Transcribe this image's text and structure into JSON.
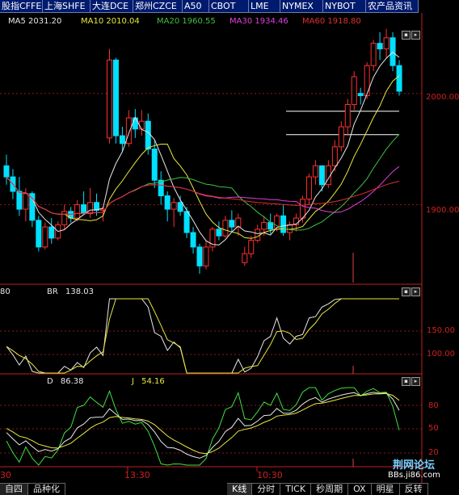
{
  "exchange_tabs": [
    "股指CFFEX",
    "上海SHFE",
    "大连DCE",
    "郑州CZCE",
    "A50",
    "CBOT",
    "LME",
    "NYMEX",
    "NYBOT",
    "农产品资讯"
  ],
  "ma_legend": [
    {
      "label": "MA5 2031.20",
      "color": "#e8e8e8"
    },
    {
      "label": "MA10 2010.04",
      "color": "#e8e840"
    },
    {
      "label": "MA20 1960.55",
      "color": "#40c040"
    },
    {
      "label": "MA30 1934.46",
      "color": "#e040e0"
    },
    {
      "label": "MA60  1918.80",
      "color": "#e03030"
    }
  ],
  "price_axis": [
    "2000.00",
    "1900.00"
  ],
  "br_panel": {
    "left": "80",
    "name": "BR",
    "value": "138.03",
    "axis": [
      "150.00",
      "100.00"
    ]
  },
  "kdj_panel": {
    "d_label": "D",
    "d_value": "86.38",
    "j_label": "J",
    "j_value": "54.16",
    "axis": [
      "80",
      "50",
      "20"
    ]
  },
  "time_axis": [
    "13:30",
    "10:30"
  ],
  "left_time_fragment": "30",
  "bottom_tabs": [
    "自四",
    "品种化",
    "K线",
    "分时",
    "TICK",
    "秒周期",
    "OX",
    "明星",
    "反转"
  ],
  "watermark": {
    "main": "荆网论坛",
    "sub": "BBs.ji86.com"
  },
  "chart_data": {
    "type": "candlestick",
    "price_range": [
      1830,
      2060
    ],
    "candles_ohlc": [
      [
        1935,
        1945,
        1918,
        1925
      ],
      [
        1925,
        1932,
        1905,
        1912
      ],
      [
        1912,
        1925,
        1890,
        1896
      ],
      [
        1896,
        1915,
        1885,
        1910
      ],
      [
        1910,
        1912,
        1880,
        1886
      ],
      [
        1886,
        1890,
        1858,
        1862
      ],
      [
        1862,
        1884,
        1860,
        1880
      ],
      [
        1880,
        1888,
        1865,
        1870
      ],
      [
        1870,
        1885,
        1868,
        1882
      ],
      [
        1882,
        1900,
        1878,
        1894
      ],
      [
        1894,
        1898,
        1884,
        1888
      ],
      [
        1888,
        1904,
        1885,
        1900
      ],
      [
        1900,
        1912,
        1895,
        1892
      ],
      [
        1892,
        1915,
        1888,
        1902
      ],
      [
        1902,
        1910,
        1890,
        1895
      ],
      [
        1895,
        1898,
        1885,
        1896
      ],
      [
        1960,
        2040,
        1955,
        2030
      ],
      [
        2030,
        2032,
        1955,
        1962
      ],
      [
        1962,
        1970,
        1948,
        1955
      ],
      [
        1955,
        1985,
        1952,
        1978
      ],
      [
        1978,
        1986,
        1960,
        1968
      ],
      [
        1968,
        1985,
        1962,
        1975
      ],
      [
        1975,
        1982,
        1945,
        1950
      ],
      [
        1950,
        1958,
        1915,
        1922
      ],
      [
        1922,
        1930,
        1900,
        1908
      ],
      [
        1908,
        1912,
        1885,
        1896
      ],
      [
        1896,
        1906,
        1880,
        1902
      ],
      [
        1902,
        1908,
        1890,
        1894
      ],
      [
        1894,
        1898,
        1870,
        1875
      ],
      [
        1875,
        1880,
        1856,
        1862
      ],
      [
        1862,
        1865,
        1838,
        1845
      ],
      [
        1845,
        1868,
        1842,
        1862
      ],
      [
        1862,
        1880,
        1858,
        1878
      ],
      [
        1878,
        1885,
        1868,
        1872
      ],
      [
        1872,
        1890,
        1870,
        1886
      ],
      [
        1886,
        1895,
        1876,
        1880
      ],
      [
        1880,
        1892,
        1872,
        1888
      ],
      [
        1848,
        1862,
        1845,
        1856
      ],
      [
        1856,
        1872,
        1852,
        1868
      ],
      [
        1868,
        1882,
        1866,
        1878
      ],
      [
        1878,
        1890,
        1872,
        1884
      ],
      [
        1884,
        1892,
        1874,
        1878
      ],
      [
        1878,
        1892,
        1876,
        1890
      ],
      [
        1890,
        1900,
        1872,
        1875
      ],
      [
        1875,
        1885,
        1868,
        1882
      ],
      [
        1882,
        1892,
        1876,
        1888
      ],
      [
        1888,
        1908,
        1884,
        1905
      ],
      [
        1905,
        1928,
        1900,
        1925
      ],
      [
        1925,
        1940,
        1918,
        1935
      ],
      [
        1935,
        1935,
        1912,
        1918
      ],
      [
        1918,
        1940,
        1915,
        1935
      ],
      [
        1935,
        1958,
        1930,
        1952
      ],
      [
        1952,
        1975,
        1948,
        1970
      ],
      [
        1970,
        1995,
        1962,
        1990
      ],
      [
        1990,
        2020,
        1985,
        2015
      ],
      [
        2000,
        2005,
        1990,
        1998
      ],
      [
        1998,
        2028,
        1995,
        2025
      ],
      [
        2025,
        2048,
        2020,
        2045
      ],
      [
        2045,
        2055,
        2030,
        2040
      ],
      [
        2040,
        2058,
        2032,
        2050
      ],
      [
        2050,
        2055,
        2020,
        2025
      ],
      [
        2025,
        2030,
        1998,
        2002
      ]
    ],
    "ma_series_names": [
      "MA5",
      "MA10",
      "MA20",
      "MA30",
      "MA60"
    ],
    "horizontal_lines": [
      1984,
      1963
    ],
    "br_range": [
      60,
      200
    ],
    "kdj_range": [
      0,
      100
    ]
  }
}
